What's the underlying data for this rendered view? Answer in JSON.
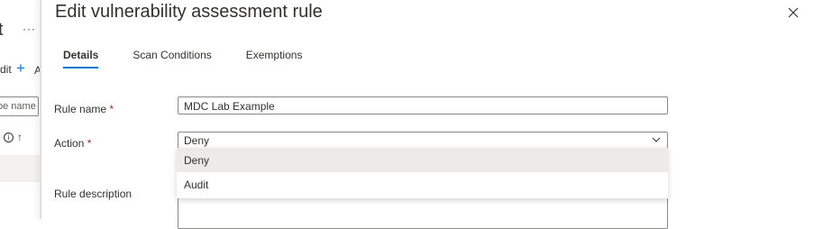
{
  "background": {
    "title_fragment": "t",
    "ellipsis": "···",
    "edit_fragment": "dit",
    "add_fragment": "A",
    "search_fragment": "pe name",
    "sort_arrow": "↑"
  },
  "panel": {
    "title": "Edit vulnerability assessment rule",
    "tabs": [
      {
        "label": "Details",
        "active": true
      },
      {
        "label": "Scan Conditions",
        "active": false
      },
      {
        "label": "Exemptions",
        "active": false
      }
    ],
    "fields": {
      "rule_name": {
        "label": "Rule name",
        "required_mark": "*",
        "value": "MDC Lab Example"
      },
      "action": {
        "label": "Action",
        "required_mark": "*",
        "value": "Deny"
      },
      "rule_description": {
        "label": "Rule description"
      }
    },
    "action_options": [
      {
        "label": "Deny",
        "selected": true
      },
      {
        "label": "Audit",
        "selected": false
      }
    ]
  },
  "colors": {
    "accent": "#0078d4",
    "required": "#a4262c"
  },
  "icons": {
    "close": "close-icon",
    "chevron": "chevron-down-icon",
    "plus": "plus-icon",
    "info": "info-icon"
  }
}
